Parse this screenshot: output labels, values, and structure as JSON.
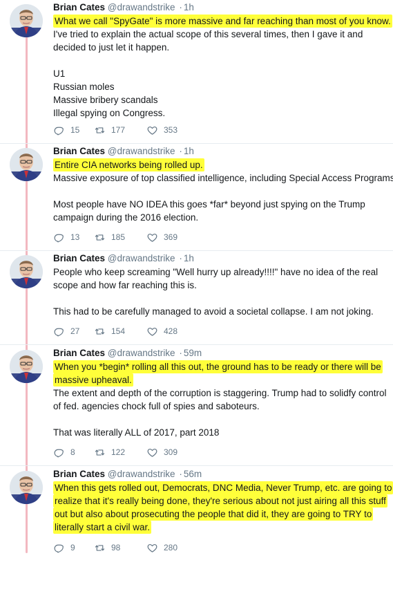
{
  "colors": {
    "highlight": "#ffff3a",
    "thread_line": "#f2b8c0",
    "text": "#14171a",
    "muted": "#657786"
  },
  "tweets": [
    {
      "name": "Brian Cates",
      "handle": "@drawandstrike",
      "separator": "·",
      "time": "1h",
      "highlight_lines": [
        "What we call \"SpyGate\" is more massive and far reaching than most of you know."
      ],
      "paragraphs": [
        [
          "I've tried to explain the actual scope of this several times, then I gave it and",
          "decided to just let it happen."
        ],
        [
          "U1",
          "Russian moles",
          "Massive bribery scandals",
          "Illegal spying on Congress."
        ]
      ],
      "replies": "15",
      "retweets": "177",
      "likes": "353"
    },
    {
      "name": "Brian Cates",
      "handle": "@drawandstrike",
      "separator": "·",
      "time": "1h",
      "highlight_lines": [
        "Entire CIA networks being rolled up."
      ],
      "paragraphs": [
        [
          "Massive exposure of top classified intelligence, including Special Access Programs."
        ],
        [
          "Most people have NO IDEA this goes *far* beyond just spying on the Trump",
          "campaign during the 2016 election."
        ]
      ],
      "replies": "13",
      "retweets": "185",
      "likes": "369"
    },
    {
      "name": "Brian Cates",
      "handle": "@drawandstrike",
      "separator": "·",
      "time": "1h",
      "highlight_lines": [],
      "paragraphs": [
        [
          "People who keep screaming \"Well hurry up already!!!!\" have no idea of the real",
          "scope and how far reaching this is."
        ],
        [
          "This had to be carefully managed to avoid a societal collapse. I am not joking."
        ]
      ],
      "replies": "27",
      "retweets": "154",
      "likes": "428"
    },
    {
      "name": "Brian Cates",
      "handle": "@drawandstrike",
      "separator": "·",
      "time": "59m",
      "highlight_lines": [
        "When you *begin* rolling all this out, the ground has to be ready or there will be",
        "massive upheaval."
      ],
      "paragraphs": [
        [
          "The extent and depth of the corruption is staggering. Trump had to solidfy control",
          "of fed. agencies chock full of spies and saboteurs."
        ],
        [
          "That was literally ALL of 2017, part 2018"
        ]
      ],
      "replies": "8",
      "retweets": "122",
      "likes": "309"
    },
    {
      "name": "Brian Cates",
      "handle": "@drawandstrike",
      "separator": "·",
      "time": "56m",
      "highlight_lines": [
        "When this gets rolled out, Democrats, DNC Media, Never Trump, etc. are going to",
        "realize that it's really being done, they're serious about not just airing all this stuff",
        "out but also about prosecuting the people that did it, they are going to TRY to",
        "literally start a civil war."
      ],
      "paragraphs": [],
      "replies": "9",
      "retweets": "98",
      "likes": "280"
    }
  ]
}
